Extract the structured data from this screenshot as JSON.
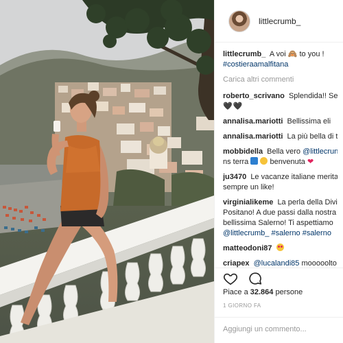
{
  "post": {
    "username": "littlecrumb_",
    "caption": {
      "user": "littlecrumb_",
      "text_before": "A voi",
      "emoji": "🙈",
      "text_after": "to you !",
      "hashtag": "#costieraamalfitana"
    },
    "load_more": "Carica altri commenti",
    "comments": [
      {
        "user": "roberto_scrivano",
        "text": "Splendida!! See",
        "extra": "🖤🖤"
      },
      {
        "user": "annalisa.mariotti",
        "text": "Bellissima eli"
      },
      {
        "user": "annalisa.mariotti",
        "text": "La più bella di t"
      },
      {
        "user": "mobbidella",
        "text": "Bella vero",
        "mention": "@littlecrun",
        "line2": "ns terra",
        "line2b": "benvenuta"
      },
      {
        "user": "ju3470",
        "text": "Le vacanze italiane merita",
        "line2": "sempre un like!"
      },
      {
        "user": "virginialikeme",
        "text": "La perla della Divi",
        "line2": "Positano! A due passi dalla nostra",
        "line3": "bellissima Salerno! Ti aspettiamo",
        "mention": "@littlecrumb_",
        "tag1": "#salerno",
        "tag2": "#salerno"
      },
      {
        "user": "matteodoni87",
        "text": ""
      },
      {
        "user": "criapex",
        "mention": "@lucalandi85",
        "text": "mooooolto"
      }
    ],
    "likes_label": "Piace a",
    "likes_count": "32.864",
    "likes_suffix": "persone",
    "time_ago": "1 GIORNO FA",
    "add_comment_placeholder": "Aggiungi un commento..."
  },
  "colors": {
    "link": "#003569",
    "muted": "#999999",
    "text": "#262626"
  },
  "icons": [
    "heart-icon",
    "comment-bubble-icon"
  ]
}
